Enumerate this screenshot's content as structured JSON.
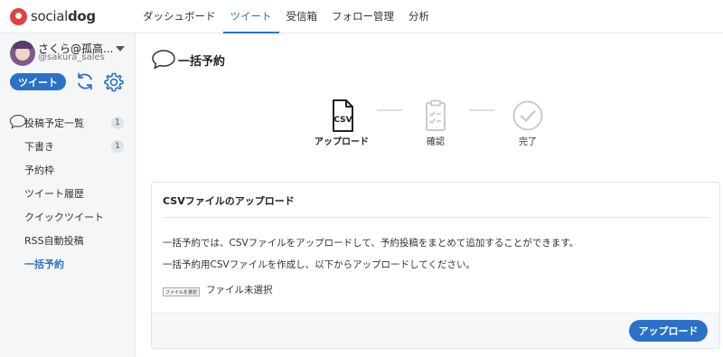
{
  "brand": {
    "name_light": "social",
    "name_bold": "dog",
    "color": "#e0433f"
  },
  "nav": {
    "items": [
      {
        "label": "ダッシュボード",
        "active": false
      },
      {
        "label": "ツイート",
        "active": true
      },
      {
        "label": "受信箱",
        "active": false
      },
      {
        "label": "フォロー管理",
        "active": false
      },
      {
        "label": "分析",
        "active": false
      }
    ]
  },
  "account": {
    "name": "さくら@孤高...",
    "handle": "@sakura_sales"
  },
  "sidebar": {
    "tweet_button": "ツイート",
    "icons": [
      "refresh-icon",
      "gear-icon"
    ],
    "items": [
      {
        "label": "投稿予定一覧",
        "badge": "1"
      },
      {
        "label": "下書き",
        "badge": "1"
      },
      {
        "label": "予約枠"
      },
      {
        "label": "ツイート履歴"
      },
      {
        "label": "クイックツイート"
      },
      {
        "label": "RSS自動投稿"
      },
      {
        "label": "一括予約",
        "active": true
      }
    ]
  },
  "page": {
    "title": "一括予約",
    "icon": "speech-bubble-icon"
  },
  "steps": [
    {
      "label": "アップロード",
      "state": "active",
      "icon": "csv-file-icon",
      "icon_text": "CSV"
    },
    {
      "label": "確認",
      "state": "inactive",
      "icon": "clipboard-check-icon"
    },
    {
      "label": "完了",
      "state": "inactive",
      "icon": "check-circle-icon"
    }
  ],
  "card": {
    "title": "CSVファイルのアップロード",
    "text1": "一括予約では、CSVファイルをアップロードして、予約投稿をまとめて追加することができます。",
    "text2": "一括予約用CSVファイルを作成し、以下からアップロードしてください。",
    "file_button": "ファイルを選択",
    "file_status": "ファイル未選択",
    "upload_button": "アップロード"
  },
  "colors": {
    "accent": "#2a72c7",
    "inactive": "#c8ccd1"
  }
}
